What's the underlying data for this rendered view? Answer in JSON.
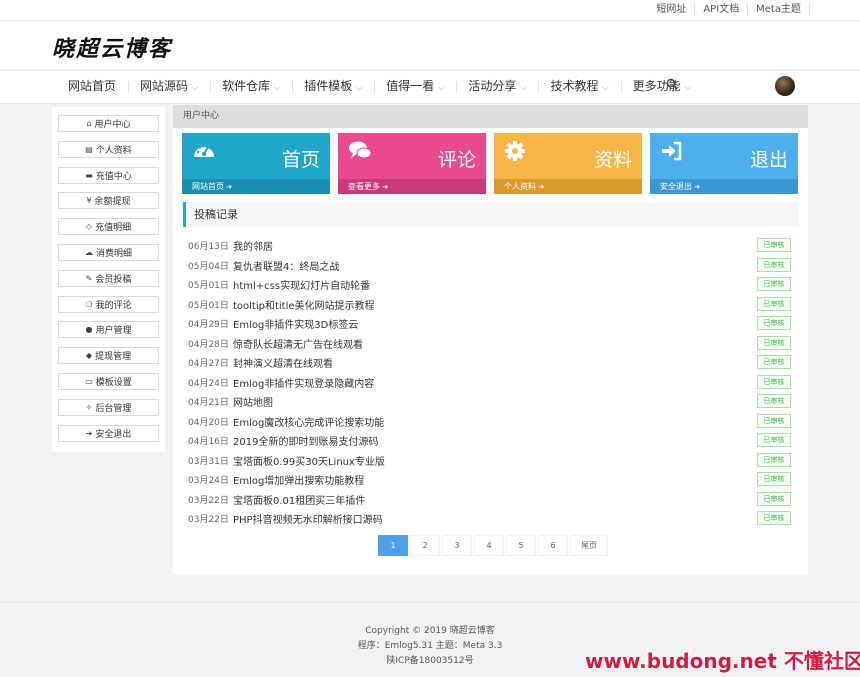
{
  "topbar": {
    "links": [
      "短网址",
      "API文档",
      "Meta主题"
    ]
  },
  "logo": {
    "text": "晓超云博客"
  },
  "nav": {
    "items": [
      {
        "label": "网站首页",
        "dropdown": false
      },
      {
        "label": "网站源码",
        "dropdown": true
      },
      {
        "label": "软件仓库",
        "dropdown": true
      },
      {
        "label": "插件模板",
        "dropdown": true
      },
      {
        "label": "值得一看",
        "dropdown": true
      },
      {
        "label": "活动分享",
        "dropdown": true
      },
      {
        "label": "技术教程",
        "dropdown": true
      },
      {
        "label": "更多功能",
        "dropdown": true
      }
    ],
    "caret": "⌵"
  },
  "sidebar": {
    "items": [
      {
        "icon": "home-icon",
        "glyph": "⌂",
        "label": "用户中心"
      },
      {
        "icon": "id-card-icon",
        "glyph": "▤",
        "label": "个人资料"
      },
      {
        "icon": "credit-card-icon",
        "glyph": "▬",
        "label": "充值中心"
      },
      {
        "icon": "yen-icon",
        "glyph": "¥",
        "label": "余额提现"
      },
      {
        "icon": "diamond-icon",
        "glyph": "◇",
        "label": "充值明细"
      },
      {
        "icon": "cloud-icon",
        "glyph": "☁",
        "label": "消费明细"
      },
      {
        "icon": "edit-icon",
        "glyph": "✎",
        "label": "会员投稿"
      },
      {
        "icon": "comments-icon",
        "glyph": "❍",
        "label": "我的评论"
      },
      {
        "icon": "user-icon",
        "glyph": "●",
        "label": "用户管理"
      },
      {
        "icon": "box-icon",
        "glyph": "◆",
        "label": "提现管理"
      },
      {
        "icon": "monitor-icon",
        "glyph": "▭",
        "label": "模板设置"
      },
      {
        "icon": "wrench-icon",
        "glyph": "✧",
        "label": "后台管理"
      },
      {
        "icon": "logout-icon",
        "glyph": "➜",
        "label": "安全退出"
      }
    ]
  },
  "main": {
    "breadcrumb": "用户中心",
    "tiles": [
      {
        "title": "首页",
        "footer": "网站首页",
        "icon": "dashboard-icon",
        "color": "#1fa6c9",
        "foot_color": "#1a8fb0"
      },
      {
        "title": "评论",
        "footer": "查看更多",
        "icon": "comments-icon",
        "color": "#e8498f",
        "foot_color": "#c93a7a"
      },
      {
        "title": "资料",
        "footer": "个人资料",
        "icon": "cog-icon",
        "color": "#f7b545",
        "foot_color": "#d99a2e"
      },
      {
        "title": "退出",
        "footer": "安全退出",
        "icon": "sign-in-icon",
        "color": "#4db0ec",
        "foot_color": "#3998d4"
      }
    ],
    "section_title": "投稿记录",
    "status_label": "已审核",
    "posts": [
      {
        "date": "06月13日",
        "title": "我的邻居"
      },
      {
        "date": "05月04日",
        "title": "复仇者联盟4：终局之战"
      },
      {
        "date": "05月01日",
        "title": "html+css实现幻灯片自动轮番"
      },
      {
        "date": "05月01日",
        "title": "tooltip和title美化网站提示教程"
      },
      {
        "date": "04月29日",
        "title": "Emlog非插件实现3D标签云"
      },
      {
        "date": "04月28日",
        "title": "惊奇队长超清无广告在线观看"
      },
      {
        "date": "04月27日",
        "title": "封神演义超清在线观看"
      },
      {
        "date": "04月24日",
        "title": "Emlog非插件实现登录隐藏内容"
      },
      {
        "date": "04月21日",
        "title": "网站地图"
      },
      {
        "date": "04月20日",
        "title": "Emlog魔改核心完成评论搜索功能"
      },
      {
        "date": "04月16日",
        "title": "2019全新的即时到账易支付源码"
      },
      {
        "date": "03月31日",
        "title": "宝塔面板0.99买30天Linux专业版"
      },
      {
        "date": "03月24日",
        "title": "Emlog增加弹出搜索功能教程"
      },
      {
        "date": "03月22日",
        "title": "宝塔面板0.01租团买三年插件"
      },
      {
        "date": "03月22日",
        "title": "PHP抖音视频无水印解析接口源码"
      }
    ],
    "pager": {
      "pages": [
        "1",
        "2",
        "3",
        "4",
        "5",
        "6"
      ],
      "last": "尾页",
      "current": "1"
    }
  },
  "footer": {
    "copyright": "Copyright © 2019  晓超云博客",
    "program": "程序：Emlog5.31    主题：Meta 3.3",
    "icp": "陕ICP备18003512号"
  },
  "watermark": {
    "text": "www.budong.net 不懂社区"
  }
}
